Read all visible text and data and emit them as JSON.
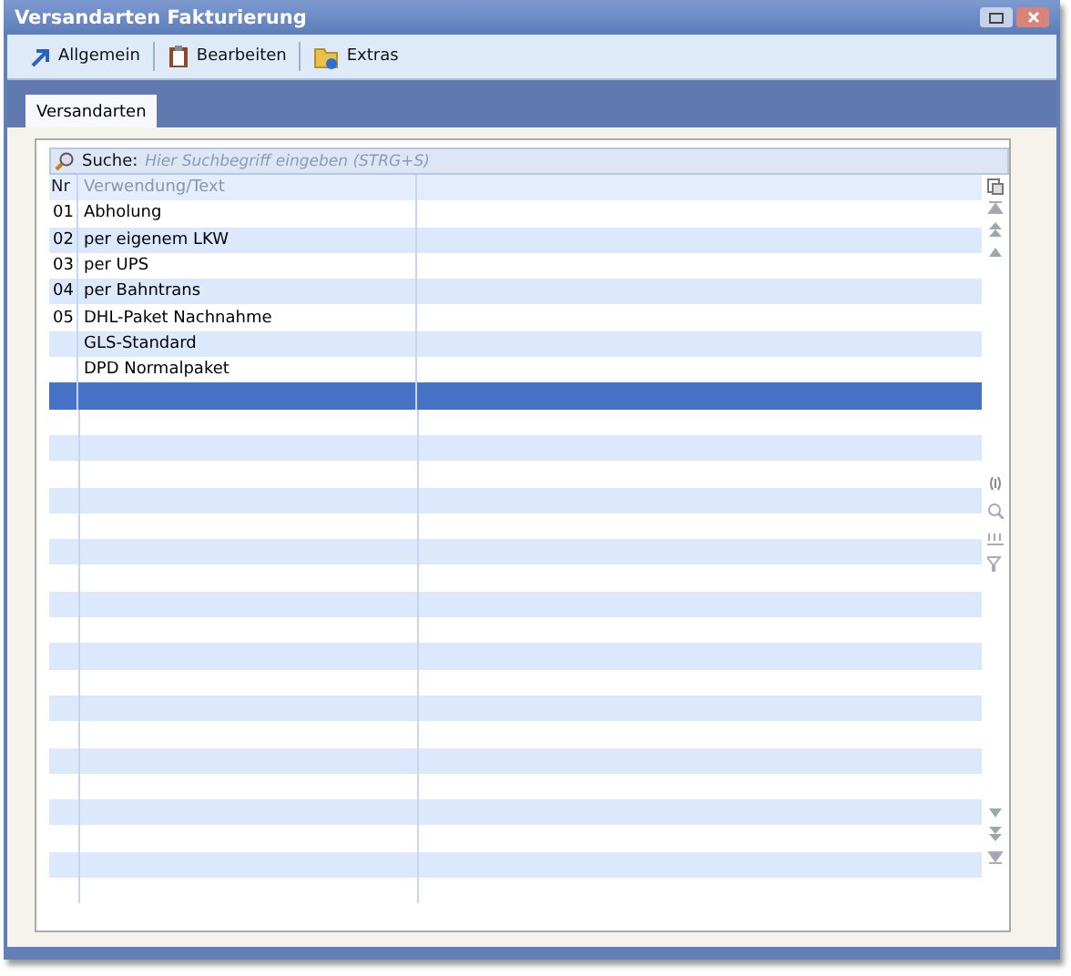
{
  "window": {
    "title": "Versandarten Fakturierung"
  },
  "toolbar": [
    {
      "label": "Allgemein",
      "kind": "arrow"
    },
    {
      "label": "Bearbeiten",
      "kind": "clipboard"
    },
    {
      "label": "Extras",
      "kind": "folder"
    }
  ],
  "tabs": [
    {
      "label": "Versandarten",
      "selected": true
    }
  ],
  "search": {
    "label": "Suche:",
    "placeholder": "Hier Suchbegriff eingeben (STRG+S)"
  },
  "table": {
    "columns": [
      "Nr",
      "Verwendung/Text"
    ],
    "rows": [
      {
        "nr": "01",
        "text": "Abholung",
        "selected": false
      },
      {
        "nr": "02",
        "text": "per eigenem LKW",
        "selected": false
      },
      {
        "nr": "03",
        "text": "per UPS",
        "selected": false
      },
      {
        "nr": "04",
        "text": "per Bahntrans",
        "selected": false
      },
      {
        "nr": "05",
        "text": "DHL-Paket Nachnahme",
        "selected": false
      },
      {
        "text": "GLS-Standard",
        "selected": false
      },
      {
        "text": "DPD Normalpaket",
        "selected": false
      },
      {
        "selected": true
      }
    ]
  }
}
